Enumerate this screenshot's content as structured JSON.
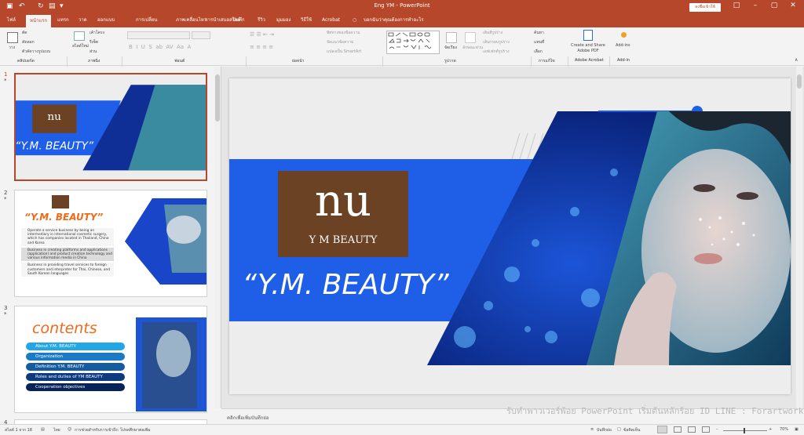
{
  "window": {
    "title": "Eng YM  -  PowerPoint",
    "signin": "ลงชื่อเข้าใช้"
  },
  "tabs": [
    "ไฟล์",
    "หน้าแรก",
    "แทรก",
    "วาด",
    "ออกแบบ",
    "การเปลี่ยน",
    "ภาพเคลื่อนไหว",
    "การนำเสนอสไลด์",
    "บันทึก",
    "รีวิว",
    "มุมมอง",
    "วิธีใช้",
    "Acrobat"
  ],
  "tell_me": "บอกฉันว่าคุณต้องการทำอะไร",
  "ribbon": {
    "groups": {
      "clipboard": "คลิปบอร์ด",
      "slides": "ภาพนิ่ง",
      "font": "ฟอนต์",
      "paragraph": "ย่อหน้า",
      "drawing": "รูปวาด",
      "editing": "การแก้ไข",
      "acrobat": "Adobe Acrobat",
      "addin": "Add-in"
    },
    "paste": "วาง",
    "cut": "ตัด",
    "copy": "คัดลอก",
    "format_painter": "ตัวคัดวางรูปแบบ",
    "new_slide": "สไลด์ใหม่",
    "layout": "เค้าโครง",
    "reset": "รีเซ็ต",
    "section": "ส่วน",
    "text_direction": "ทิศทางของข้อความ",
    "align_text": "จัดแนวข้อความ",
    "smartart": "แปลงเป็น SmartArt",
    "arrange": "จัดเรียง",
    "quick_styles": "ลักษณะด่วน",
    "shape_fill": "เติมสีรูปร่าง",
    "shape_outline": "เส้นกรอบรูปร่าง",
    "shape_effects": "เอฟเฟกต์รูปร่าง",
    "find": "ค้นหา",
    "replace": "แทนที่",
    "select": "เลือก",
    "create_share": "Create and Share Adobe PDF",
    "addins": "Add-ins"
  },
  "thumbnails": [
    {
      "num": "1",
      "star": "*",
      "title": "“Y.M. BEAUTY”"
    },
    {
      "num": "2",
      "star": "*",
      "title": "“Y.M. BEAUTY”",
      "bullets": [
        "Operate a service business by being an intermediary in international cosmetic surgery, which has companies located in Thailand, China and Korea",
        "Business in creating platforms and applications (application) and product creation technology and various information media in China",
        "Business in providing travel services to foreign customers and interpreter for Thai, Chinese, and South Korean languages"
      ]
    },
    {
      "num": "3",
      "star": "*",
      "title": "contents",
      "items": [
        "About Y.M. BEAUTY",
        "Organization",
        "Definition Y.M. BEAUTY",
        "Roles and duties of  YM BEAUTY",
        "Cooperation objectives"
      ]
    },
    {
      "num": "4",
      "star": ""
    }
  ],
  "slide": {
    "logo_mark": "nu",
    "logo_text": "Y M BEAUTY",
    "title": "“Y.M. BEAUTY”"
  },
  "notes_placeholder": "คลิกเพื่อเพิ่มบันทึกย่อ",
  "status": {
    "slide_count": "สไลด์ 1 จาก 18",
    "language": "ไทย",
    "accessibility": "การช่วยสำหรับการเข้าถึง: โปรดศึกษาต่อเพิ่ม",
    "notes": "บันทึกย่อ",
    "comments": "ข้อคิดเห็น",
    "zoom": "70%"
  },
  "watermark": "รับทำพาวเวอร์พ้อย PowerPoint เริ่มต้นหลักร้อย ID LINE : Forartwork",
  "colors": {
    "accent": "#b7472a",
    "brand_blue": "#1f5ee6",
    "logo_brown": "#6b4324"
  }
}
